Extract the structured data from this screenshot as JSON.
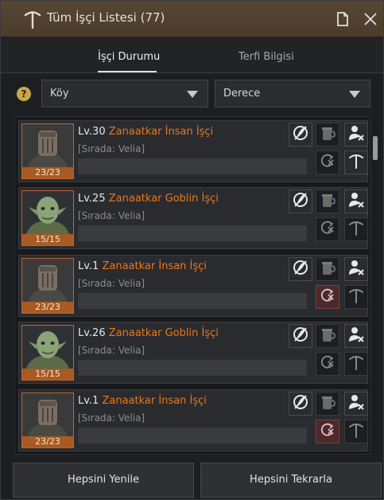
{
  "window": {
    "title": "Tüm İşçi Listesi (77)"
  },
  "tabs": [
    {
      "label": "İşçi Durumu",
      "active": true
    },
    {
      "label": "Terfi Bilgisi",
      "active": false
    }
  ],
  "filters": {
    "help": "?",
    "village": "Köy",
    "grade": "Derece"
  },
  "workers": [
    {
      "level": "Lv.30",
      "name": "Zanaatkar İnsan İşçi",
      "location": "[Sırada: Velia]",
      "stamina": "23/23",
      "race": "human",
      "repeat_red": false
    },
    {
      "level": "Lv.25",
      "name": "Zanaatkar Goblin İşçi",
      "location": "[Sırada: Velia]",
      "stamina": "15/15",
      "race": "goblin",
      "repeat_red": false
    },
    {
      "level": "Lv.1",
      "name": "Zanaatkar İnsan İşçi",
      "location": "[Sırada: Velia]",
      "stamina": "23/23",
      "race": "human",
      "repeat_red": true
    },
    {
      "level": "Lv.26",
      "name": "Zanaatkar Goblin İşçi",
      "location": "[Sırada: Velia]",
      "stamina": "15/15",
      "race": "goblin",
      "repeat_red": false
    },
    {
      "level": "Lv.1",
      "name": "Zanaatkar İnsan İşçi",
      "location": "[Sırada: Velia]",
      "stamina": "23/23",
      "race": "human",
      "repeat_red": true
    }
  ],
  "footer": {
    "refresh_all": "Hepsini Yenile",
    "repeat_all": "Hepsini Tekrarla"
  },
  "colors": {
    "accent": "#e6781e",
    "title_bar": "#574634",
    "stamina": "#a85a22"
  }
}
